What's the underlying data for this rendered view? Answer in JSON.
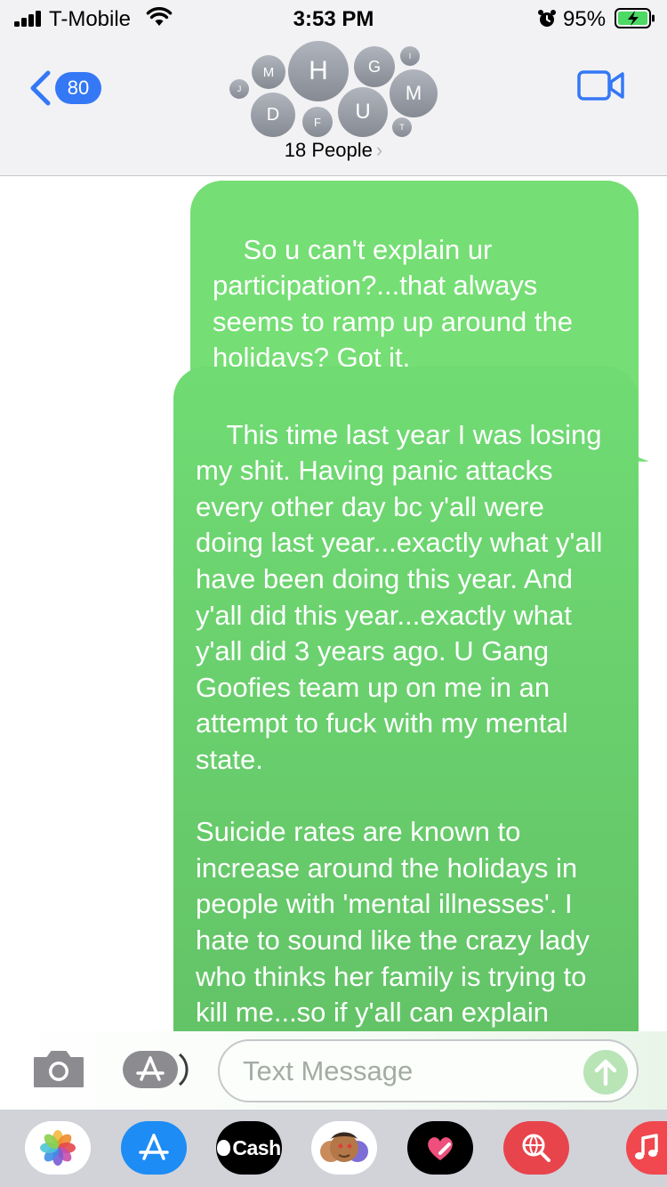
{
  "status_bar": {
    "carrier": "T-Mobile",
    "time": "3:53 PM",
    "battery_percent": "95%",
    "signal_bars": 4,
    "icons": [
      "signal-icon",
      "wifi-icon",
      "alarm-icon",
      "battery-charging-icon"
    ]
  },
  "header": {
    "back_count": "80",
    "group_label": "18 People",
    "group_chevron": "›",
    "avatars": [
      {
        "initial": "M"
      },
      {
        "initial": "H"
      },
      {
        "initial": "G"
      },
      {
        "initial": "I"
      },
      {
        "initial": "J"
      },
      {
        "initial": "D"
      },
      {
        "initial": "F"
      },
      {
        "initial": "U"
      },
      {
        "initial": "T"
      },
      {
        "initial": "M"
      }
    ],
    "video_icon": "video-camera-icon",
    "back_icon": "chevron-left-icon"
  },
  "messages": [
    {
      "sender": "me",
      "text": "So u can't explain ur participation?...that always seems to ramp up around the holidays? Got it."
    },
    {
      "sender": "me",
      "text": "This time last year I was losing my shit. Having panic attacks every other day bc y'all were doing last year...exactly what y'all have been doing this year. And y'all did this year...exactly what y'all did 3 years ago. U Gang Goofies team up on me in an attempt to fuck with my mental state.\n\nSuicide rates are known to increase around the holidays in people with 'mental illnesses'. I hate to sound like the crazy lady who thinks her family is trying to kill me...so if y'all can explain away ur behavior...that"
    }
  ],
  "input_bar": {
    "placeholder": "Text Message",
    "camera_icon": "camera-icon",
    "apps_icon": "app-store-icon",
    "send_icon": "send-arrow-icon"
  },
  "app_drawer": {
    "cash_label": "Cash",
    "apps": [
      "photos-icon",
      "app-store-icon",
      "cash-app-icon",
      "memoji-icon",
      "heart-app-icon",
      "web-search-icon",
      "music-icon"
    ]
  },
  "colors": {
    "bubble_green": "#75de74",
    "ios_blue": "#3478f6",
    "header_bg": "#f2f2f4"
  }
}
